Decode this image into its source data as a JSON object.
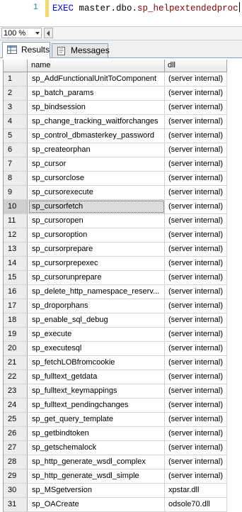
{
  "editor": {
    "line_number": "1",
    "keyword": "EXEC",
    "object_prefix": "master.dbo.",
    "procedure": "sp_helpextendedproc"
  },
  "zoom": {
    "value": "100 %"
  },
  "tabs": {
    "results": "Results",
    "messages": "Messages"
  },
  "grid": {
    "columns": [
      "name",
      "dll"
    ],
    "selected_row": 10,
    "rows": [
      {
        "n": "1",
        "name": "sp_AddFunctionalUnitToComponent",
        "dll": "(server internal)"
      },
      {
        "n": "2",
        "name": "sp_batch_params",
        "dll": "(server internal)"
      },
      {
        "n": "3",
        "name": "sp_bindsession",
        "dll": "(server internal)"
      },
      {
        "n": "4",
        "name": "sp_change_tracking_waitforchanges",
        "dll": "(server internal)"
      },
      {
        "n": "5",
        "name": "sp_control_dbmasterkey_password",
        "dll": "(server internal)"
      },
      {
        "n": "6",
        "name": "sp_createorphan",
        "dll": "(server internal)"
      },
      {
        "n": "7",
        "name": "sp_cursor",
        "dll": "(server internal)"
      },
      {
        "n": "8",
        "name": "sp_cursorclose",
        "dll": "(server internal)"
      },
      {
        "n": "9",
        "name": "sp_cursorexecute",
        "dll": "(server internal)"
      },
      {
        "n": "10",
        "name": "sp_cursorfetch",
        "dll": "(server internal)"
      },
      {
        "n": "11",
        "name": "sp_cursoropen",
        "dll": "(server internal)"
      },
      {
        "n": "12",
        "name": "sp_cursoroption",
        "dll": "(server internal)"
      },
      {
        "n": "13",
        "name": "sp_cursorprepare",
        "dll": "(server internal)"
      },
      {
        "n": "14",
        "name": "sp_cursorprepexec",
        "dll": "(server internal)"
      },
      {
        "n": "15",
        "name": "sp_cursorunprepare",
        "dll": "(server internal)"
      },
      {
        "n": "16",
        "name": "sp_delete_http_namespace_reserv...",
        "dll": "(server internal)"
      },
      {
        "n": "17",
        "name": "sp_droporphans",
        "dll": "(server internal)"
      },
      {
        "n": "18",
        "name": "sp_enable_sql_debug",
        "dll": "(server internal)"
      },
      {
        "n": "19",
        "name": "sp_execute",
        "dll": "(server internal)"
      },
      {
        "n": "20",
        "name": "sp_executesql",
        "dll": "(server internal)"
      },
      {
        "n": "21",
        "name": "sp_fetchLOBfromcookie",
        "dll": "(server internal)"
      },
      {
        "n": "22",
        "name": "sp_fulltext_getdata",
        "dll": "(server internal)"
      },
      {
        "n": "23",
        "name": "sp_fulltext_keymappings",
        "dll": "(server internal)"
      },
      {
        "n": "24",
        "name": "sp_fulltext_pendingchanges",
        "dll": "(server internal)"
      },
      {
        "n": "25",
        "name": "sp_get_query_template",
        "dll": "(server internal)"
      },
      {
        "n": "26",
        "name": "sp_getbindtoken",
        "dll": "(server internal)"
      },
      {
        "n": "27",
        "name": "sp_getschemalock",
        "dll": "(server internal)"
      },
      {
        "n": "28",
        "name": "sp_http_generate_wsdl_complex",
        "dll": "(server internal)"
      },
      {
        "n": "29",
        "name": "sp_http_generate_wsdl_simple",
        "dll": "(server internal)"
      },
      {
        "n": "30",
        "name": "sp_MSgetversion",
        "dll": "xpstar.dll"
      },
      {
        "n": "31",
        "name": "sp_OACreate",
        "dll": "odsole70.dll"
      }
    ]
  }
}
